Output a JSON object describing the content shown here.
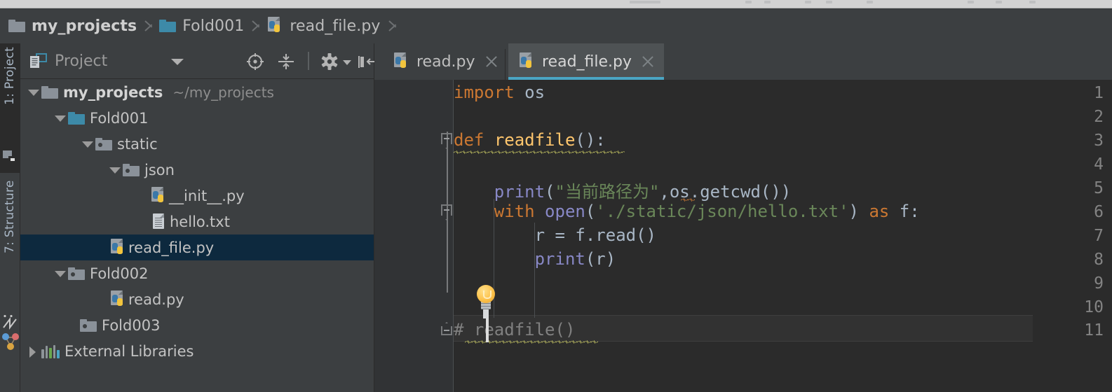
{
  "app": "PyCharm",
  "breadcrumb": {
    "name": "breadcrumb",
    "items": [
      {
        "label": "my_projects",
        "icon": "folder-gray-icon",
        "bold": true
      },
      {
        "label": "Fold001",
        "icon": "folder-blue-icon",
        "bold": false
      },
      {
        "label": "read_file.py",
        "icon": "python-file-icon",
        "bold": false
      }
    ]
  },
  "tool_strip": {
    "tabs": [
      {
        "label": "1: Project",
        "number": "1",
        "active": true
      },
      {
        "label": "7: Structure",
        "number": "7",
        "active": false
      }
    ]
  },
  "project_panel": {
    "title": "Project",
    "title_icon": "project-view-icon",
    "toolbar_buttons": [
      {
        "name": "locate-in-tree-icon",
        "tooltip": "Select Opened File"
      },
      {
        "name": "collapse-all-icon",
        "tooltip": "Collapse All"
      },
      {
        "name": "settings-gear-icon",
        "tooltip": "Settings"
      },
      {
        "name": "hide-panel-icon",
        "tooltip": "Hide"
      }
    ],
    "tree": [
      {
        "label": "my_projects",
        "sub": "~/my_projects",
        "icon": "folder-gray-icon",
        "indent": 0,
        "twisty": "open",
        "bold": true,
        "selected": false
      },
      {
        "label": "Fold001",
        "sub": "",
        "icon": "folder-blue-icon",
        "indent": 1,
        "twisty": "open",
        "bold": false,
        "selected": false
      },
      {
        "label": "static",
        "sub": "",
        "icon": "folder-dot-icon",
        "indent": 2,
        "twisty": "open",
        "bold": false,
        "selected": false
      },
      {
        "label": "json",
        "sub": "",
        "icon": "folder-dot-icon",
        "indent": 3,
        "twisty": "open",
        "bold": false,
        "selected": false
      },
      {
        "label": "__init__.py",
        "sub": "",
        "icon": "python-file-icon",
        "indent": 4,
        "twisty": "none",
        "bold": false,
        "selected": false
      },
      {
        "label": "hello.txt",
        "sub": "",
        "icon": "text-file-icon",
        "indent": 4,
        "twisty": "none",
        "bold": false,
        "selected": false
      },
      {
        "label": "read_file.py",
        "sub": "",
        "icon": "python-file-icon",
        "indent": 3,
        "twisty": "none",
        "bold": false,
        "selected": true
      },
      {
        "label": "Fold002",
        "sub": "",
        "icon": "folder-dot-icon",
        "indent": 1,
        "twisty": "open",
        "bold": false,
        "selected": false
      },
      {
        "label": "read.py",
        "sub": "",
        "icon": "python-file-icon",
        "indent": 2,
        "twisty": "none",
        "bold": false,
        "selected": false
      },
      {
        "label": "Fold003",
        "sub": "",
        "icon": "folder-dot-icon",
        "indent": 1,
        "twisty": "none",
        "bold": false,
        "selected": false
      },
      {
        "label": "External Libraries",
        "sub": "",
        "icon": "libraries-icon",
        "indent": 0,
        "twisty": "closed",
        "bold": false,
        "selected": false
      }
    ]
  },
  "editor": {
    "tabs": [
      {
        "label": "read.py",
        "icon": "python-file-icon",
        "active": false,
        "close": "close-icon"
      },
      {
        "label": "read_file.py",
        "icon": "python-file-icon",
        "active": true,
        "close": "close-icon"
      }
    ],
    "line_numbers": [
      "1",
      "2",
      "3",
      "4",
      "5",
      "6",
      "7",
      "8",
      "9",
      "10",
      "11"
    ],
    "current_line": 11,
    "caret_line": 11,
    "code": [
      {
        "n": 1,
        "text": "import os"
      },
      {
        "n": 2,
        "text": ""
      },
      {
        "n": 3,
        "text": "def readfile():"
      },
      {
        "n": 4,
        "text": ""
      },
      {
        "n": 5,
        "text": "    print(\"当前路径为\",os.getcwd())"
      },
      {
        "n": 6,
        "text": "    with open('./static/json/hello.txt') as f:"
      },
      {
        "n": 7,
        "text": "        r = f.read()"
      },
      {
        "n": 8,
        "text": "        print(r)"
      },
      {
        "n": 9,
        "text": ""
      },
      {
        "n": 10,
        "text": ""
      },
      {
        "n": 11,
        "text": "# readfile()"
      }
    ],
    "inspection_icon": "lightbulb-icon",
    "fold_markers": [
      3,
      6,
      11
    ]
  },
  "colors": {
    "chrome": "#d2d2d2",
    "panel_bg": "#3c3f41",
    "editor_bg": "#2b2b2b",
    "gutter_bg": "#313335",
    "selection": "#0d293e",
    "tab_active": "#4e5254",
    "tab_underline": "#4aa5c4",
    "keyword": "#cc7832",
    "function": "#ffc66d",
    "builtin": "#8888c6",
    "string": "#6a8759",
    "comment": "#808080",
    "plain": "#a9b7c6",
    "line_number": "#838383",
    "folder_blue": "#3d8aa8",
    "folder_gray": "#8a9199"
  }
}
